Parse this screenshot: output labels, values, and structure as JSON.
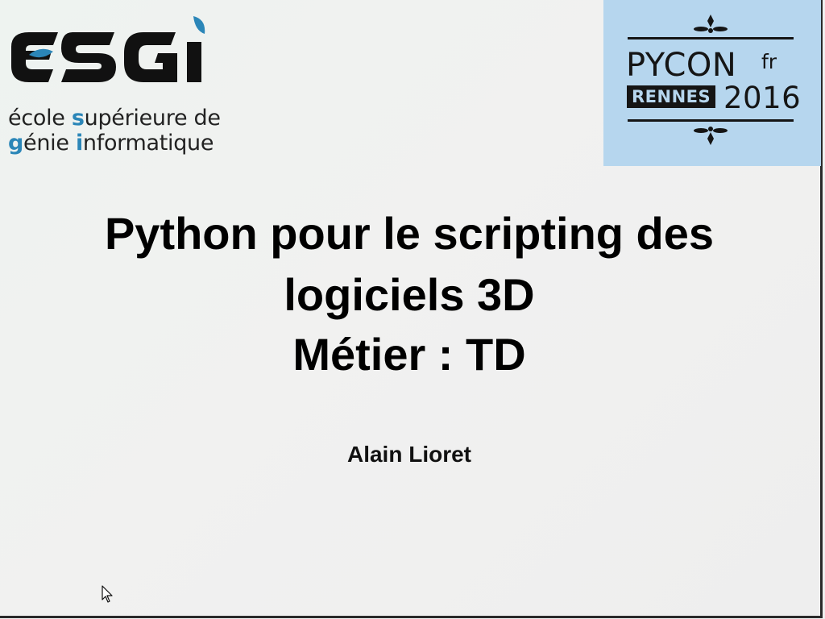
{
  "logos": {
    "esgi": {
      "wordmark": "ESGI",
      "line1": [
        {
          "text": "é",
          "style": "dark"
        },
        {
          "text": "cole ",
          "style": "dark"
        },
        {
          "text": "s",
          "style": "blue"
        },
        {
          "text": "upérieure de",
          "style": "dark"
        }
      ],
      "line2": [
        {
          "text": "g",
          "style": "blue"
        },
        {
          "text": "énie ",
          "style": "dark"
        },
        {
          "text": "i",
          "style": "blue"
        },
        {
          "text": "nformatique",
          "style": "dark"
        }
      ],
      "accent_color": "#2b86b8"
    },
    "pycon": {
      "name": "PYCON",
      "country": "fr",
      "city": "RENNES",
      "year": "2016",
      "background_color": "#b6d6ee"
    }
  },
  "slide": {
    "title_lines": [
      "Python pour le scripting des",
      "logiciels 3D",
      "Métier : TD"
    ],
    "author": "Alain Lioret"
  },
  "cursor": {
    "icon": "arrow-pointer-icon"
  }
}
